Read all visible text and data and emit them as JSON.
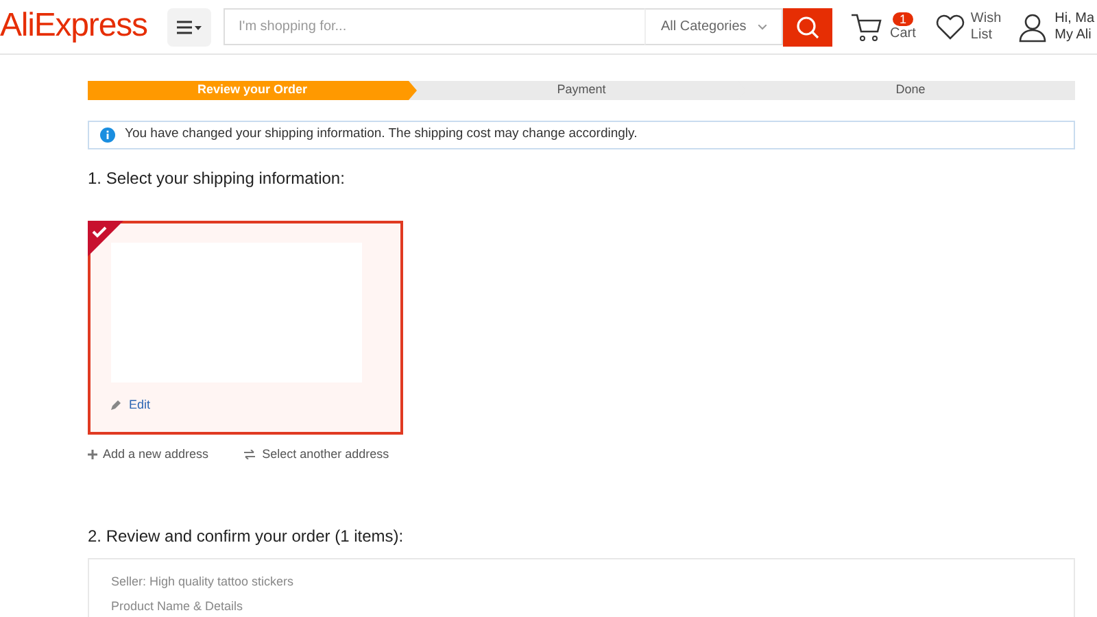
{
  "header": {
    "logo": "AliExpress",
    "search": {
      "placeholder": "I'm shopping for..."
    },
    "category": "All Categories",
    "cart": {
      "count": "1",
      "label": "Cart"
    },
    "wishlist": [
      "Wish",
      "List"
    ],
    "account": [
      "Hi, Ma",
      "My Ali"
    ]
  },
  "steps": [
    {
      "label": "Review your Order",
      "selected": true
    },
    {
      "label": "Payment",
      "selected": false
    },
    {
      "label": "Done",
      "selected": false
    }
  ],
  "notice": "You have changed your shipping information. The shipping cost may change accordingly.",
  "shipping": {
    "heading": "1. Select your shipping information:",
    "address": {
      "selected": true,
      "edit": "Edit"
    },
    "add": "Add a new address",
    "select_other": "Select another address"
  },
  "review": {
    "heading": "2. Review and confirm your order (1 items):",
    "seller": "Seller: High quality tattoo stickers",
    "product_header": "Product Name & Details"
  }
}
